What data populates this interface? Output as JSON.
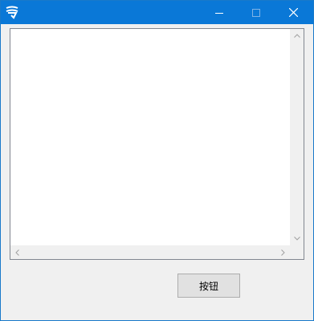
{
  "window": {
    "title": "",
    "controls": {
      "minimize_icon": "minimize-icon",
      "maximize_icon": "maximize-icon",
      "close_icon": "close-icon"
    }
  },
  "textarea": {
    "value": ""
  },
  "button": {
    "label": "按钮"
  },
  "colors": {
    "titlebar": "#0a78d7",
    "window_bg": "#f0f0f0",
    "button_bg": "#e1e1e1",
    "button_border": "#adadad"
  }
}
